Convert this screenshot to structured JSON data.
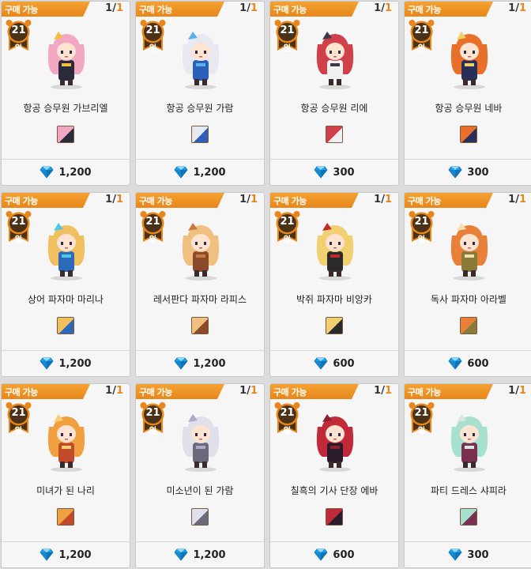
{
  "status_label": "구매 가능",
  "duration": {
    "days": "21",
    "unit": "일"
  },
  "colors": {
    "ribbon": "#e8861a",
    "badge": "#5a3d1c",
    "gem": "#1a9ee8"
  },
  "icons": {
    "price": "diamond-gem-icon",
    "duration": "clock-badge-icon"
  },
  "items": [
    {
      "name": "항공 승무원 가브리엘",
      "stock_current": "1",
      "stock_max": "1",
      "price": "1,200",
      "hair": "#f2a8c3",
      "outfit": "#2a2a3a",
      "accent": "#f2c040"
    },
    {
      "name": "항공 승무원 가람",
      "stock_current": "1",
      "stock_max": "1",
      "price": "1,200",
      "hair": "#e8e8f0",
      "outfit": "#2b5fb8",
      "accent": "#5ab0e8"
    },
    {
      "name": "항공 승무원 리에",
      "stock_current": "1",
      "stock_max": "1",
      "price": "300",
      "hair": "#d0404a",
      "outfit": "#f0f0f0",
      "accent": "#3a3a4a"
    },
    {
      "name": "항공 승무원 네바",
      "stock_current": "1",
      "stock_max": "1",
      "price": "300",
      "hair": "#e8702a",
      "outfit": "#2a2f5a",
      "accent": "#f0d060"
    },
    {
      "name": "상어 파자마 마리나",
      "stock_current": "1",
      "stock_max": "1",
      "price": "1,200",
      "hair": "#f0c060",
      "outfit": "#2a6ab8",
      "accent": "#4fc8e8"
    },
    {
      "name": "레서판다 파자마 라피스",
      "stock_current": "1",
      "stock_max": "1",
      "price": "1,200",
      "hair": "#f0c080",
      "outfit": "#8a4a2a",
      "accent": "#c87a40"
    },
    {
      "name": "박쥐 파자마 비앙카",
      "stock_current": "1",
      "stock_max": "1",
      "price": "600",
      "hair": "#f0d070",
      "outfit": "#2a2a2a",
      "accent": "#c02a2a"
    },
    {
      "name": "독사 파자마 아라벨",
      "stock_current": "1",
      "stock_max": "1",
      "price": "600",
      "hair": "#e8803a",
      "outfit": "#8a7a3a",
      "accent": "#f0e0b0"
    },
    {
      "name": "미녀가 된 나리",
      "stock_current": "1",
      "stock_max": "1",
      "price": "1,200",
      "hair": "#f0a040",
      "outfit": "#c04a2a",
      "accent": "#f8d070"
    },
    {
      "name": "미소년이 된 가람",
      "stock_current": "1",
      "stock_max": "1",
      "price": "1,200",
      "hair": "#e0e0ea",
      "outfit": "#6a6a7a",
      "accent": "#b0a8c8"
    },
    {
      "name": "칠흑의 기사 단장 에바",
      "stock_current": "1",
      "stock_max": "1",
      "price": "600",
      "hair": "#c02a3a",
      "outfit": "#2a1a2a",
      "accent": "#8a2030"
    },
    {
      "name": "파티 드레스 샤피라",
      "stock_current": "1",
      "stock_max": "1",
      "price": "300",
      "hair": "#a8e0d0",
      "outfit": "#7a3050",
      "accent": "#d8e8e0"
    }
  ]
}
